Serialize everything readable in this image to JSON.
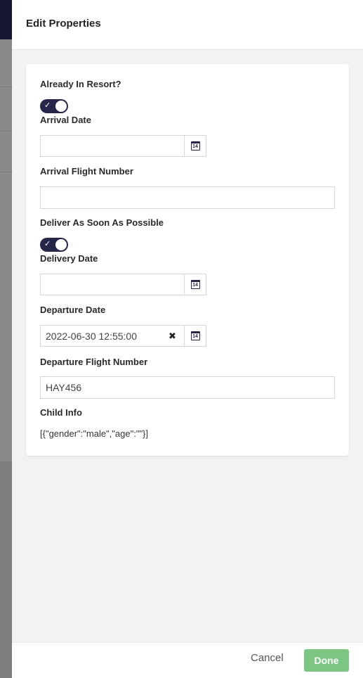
{
  "drawer": {
    "title": "Edit Properties"
  },
  "fields": {
    "already_in_resort": {
      "label": "Already In Resort?",
      "checked": true
    },
    "arrival_date": {
      "label": "Arrival Date",
      "value": ""
    },
    "arrival_flight": {
      "label": "Arrival Flight Number",
      "value": ""
    },
    "deliver_asap": {
      "label": "Deliver As Soon As Possible",
      "checked": true
    },
    "delivery_date": {
      "label": "Delivery Date",
      "value": ""
    },
    "departure_date": {
      "label": "Departure Date",
      "value": "2022-06-30 12:55:00",
      "clear_glyph": "✖"
    },
    "departure_flight": {
      "label": "Departure Flight Number",
      "value": "HAY456"
    },
    "child_info": {
      "label": "Child Info",
      "value": "[{\"gender\":\"male\",\"age\":\"\"}]"
    }
  },
  "calendar_icon": {
    "name": "calendar-icon",
    "day": "14"
  },
  "footer": {
    "cancel_label": "Cancel",
    "done_label": "Done"
  },
  "colors": {
    "toggle_on": "#26264a",
    "done_button": "#7cc583",
    "header_bar": "#141530"
  }
}
